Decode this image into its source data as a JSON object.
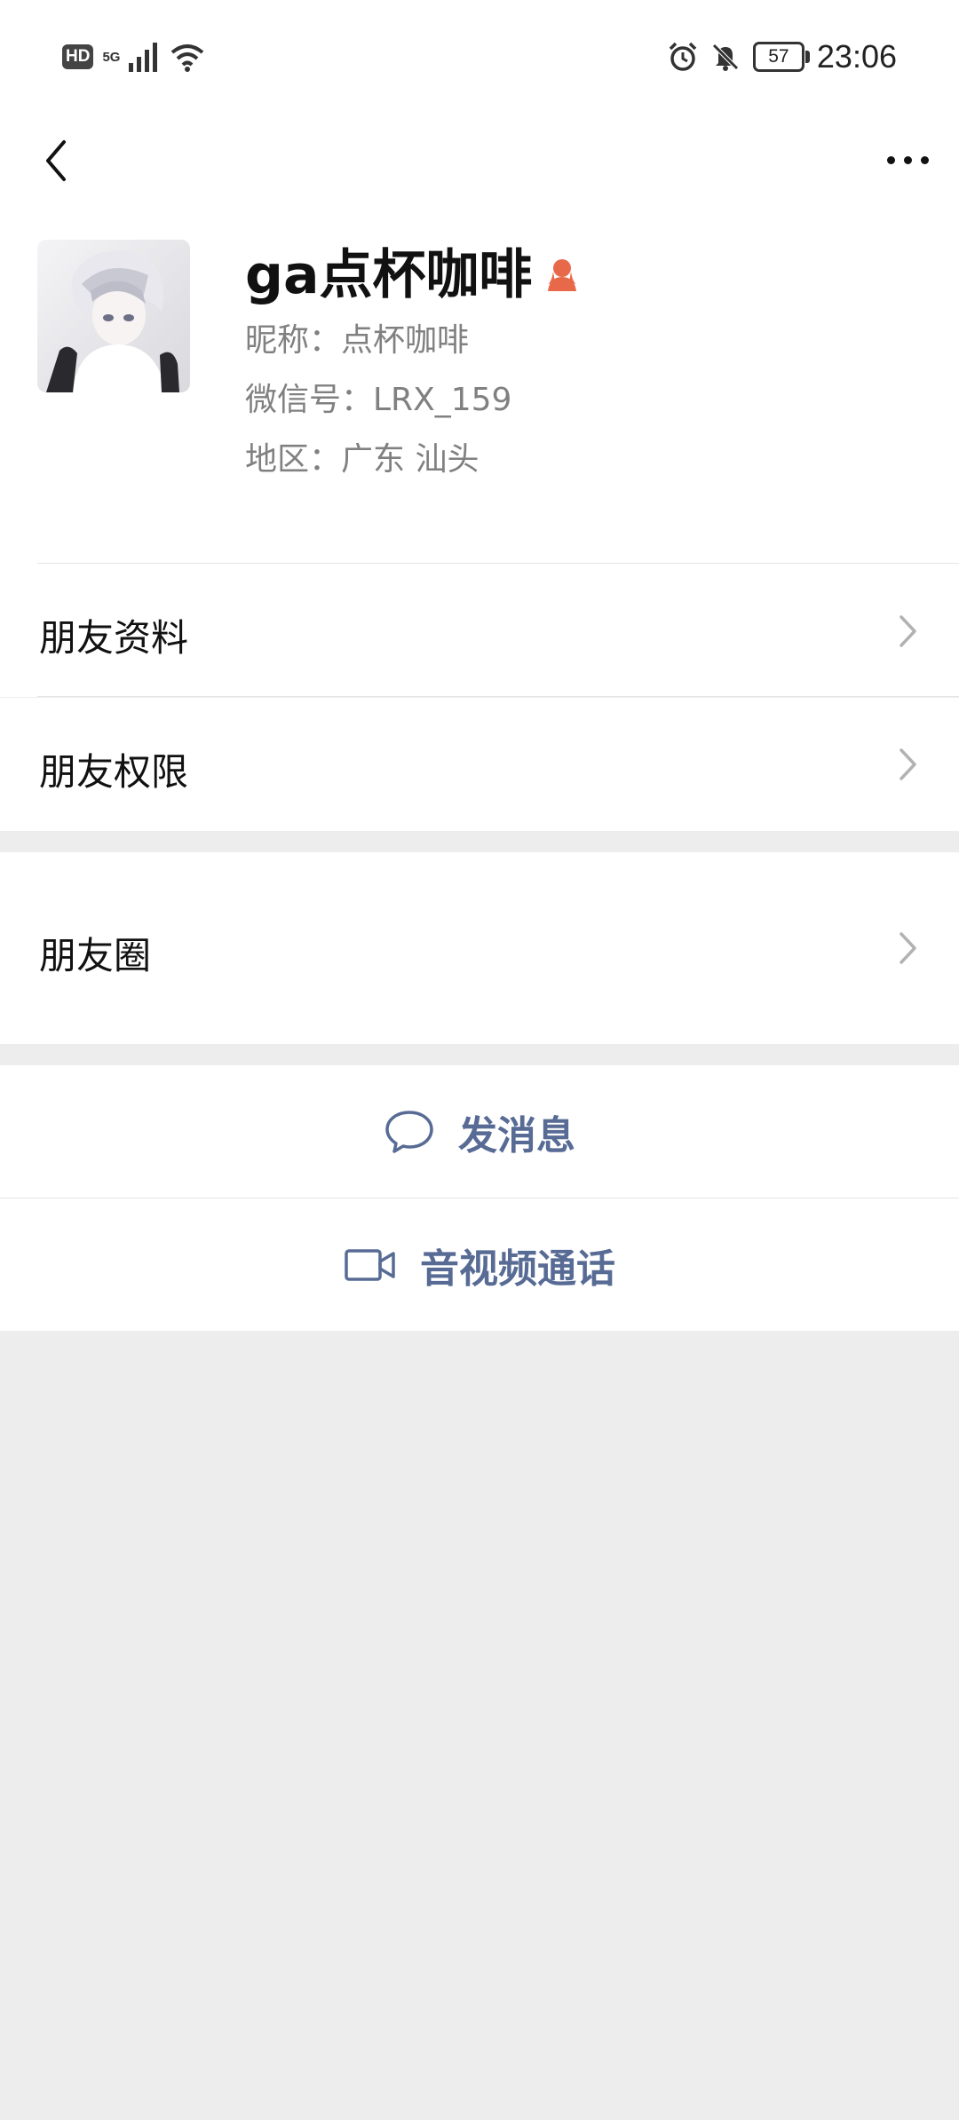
{
  "status_bar": {
    "hd": "HD",
    "network": "5G",
    "clock": "23:06",
    "battery": "57",
    "icons": [
      "signal-icon",
      "wifi-icon",
      "alarm-icon",
      "mute-icon",
      "battery-icon"
    ]
  },
  "nav": {
    "back_icon": "chevron-left-icon",
    "more_icon": "more-dots-icon"
  },
  "profile": {
    "name": "ga点杯咖啡",
    "nickname_line": "昵称：点杯咖啡",
    "wechat_id_line": "微信号：LRX_159",
    "region_line": "地区：广东  汕头",
    "gender_icon": "female-icon",
    "gender_color": "#e8694a"
  },
  "rows": {
    "friend_profile": "朋友资料",
    "friend_permissions": "朋友权限",
    "moments": "朋友圈"
  },
  "actions": {
    "send_message": "发消息",
    "video_call": "音视频通话"
  },
  "colors": {
    "accent_link": "#576b95",
    "background": "#ededed"
  }
}
